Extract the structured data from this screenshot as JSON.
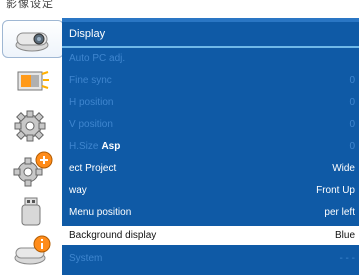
{
  "header": {
    "partial_text": "影像设定"
  },
  "sidebar": {
    "items": [
      {
        "icon": "projector-icon",
        "active": true
      },
      {
        "icon": "display-adjust-icon",
        "active": false
      },
      {
        "icon": "gear-icon",
        "active": false
      },
      {
        "icon": "gear-plus-icon",
        "active": false
      },
      {
        "icon": "usb-icon",
        "active": false
      },
      {
        "icon": "info-icon",
        "active": false
      }
    ]
  },
  "menu": {
    "title": "Display",
    "rows": [
      {
        "label": "Auto PC adj.",
        "value": "",
        "state": "disabled"
      },
      {
        "label": "Fine sync",
        "value": "0",
        "state": "disabled"
      },
      {
        "label": "H  position",
        "value": "0",
        "state": "disabled"
      },
      {
        "label": "V  position",
        "value": "0",
        "state": "disabled"
      },
      {
        "label": "H.Size",
        "label_overlay": "Asp",
        "value": "0",
        "state": "disabled"
      },
      {
        "label": "ect  Project",
        "value": "Wide",
        "state": "enabled"
      },
      {
        "label": "way",
        "value": "Front  Up",
        "state": "enabled"
      },
      {
        "label": "Menu position",
        "value": "per left",
        "state": "enabled"
      },
      {
        "label": "Background display",
        "value": "Blue",
        "state": "selected"
      },
      {
        "label": "System",
        "value": "- - -",
        "state": "disabled"
      }
    ]
  },
  "colors": {
    "panel_bg": "#0f5aa6",
    "disabled_text": "#3f86cf",
    "selected_bg": "#ffffff"
  }
}
